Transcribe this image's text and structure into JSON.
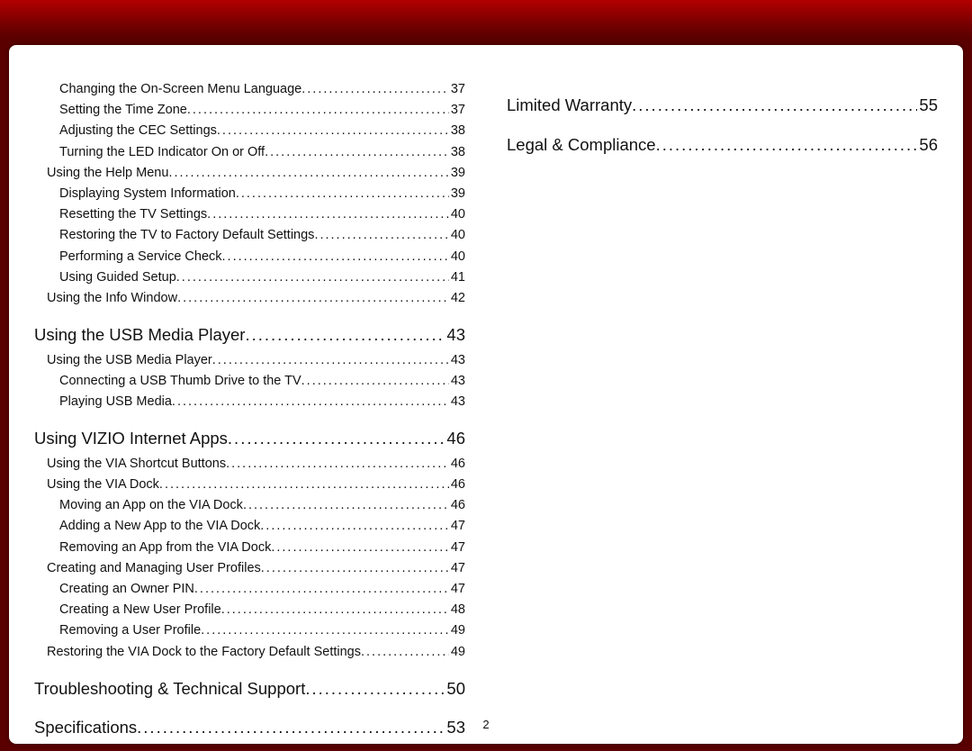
{
  "page_number": "2",
  "columns": [
    [
      {
        "level": 2,
        "title": "Changing the On-Screen Menu Language",
        "page": "37"
      },
      {
        "level": 2,
        "title": "Setting the Time Zone",
        "page": "37"
      },
      {
        "level": 2,
        "title": "Adjusting the CEC Settings",
        "page": "38"
      },
      {
        "level": 2,
        "title": "Turning the LED Indicator On or Off",
        "page": "38"
      },
      {
        "level": 1,
        "title": "Using the Help Menu",
        "page": "39"
      },
      {
        "level": 2,
        "title": "Displaying System Information",
        "page": "39"
      },
      {
        "level": 2,
        "title": "Resetting the TV Settings",
        "page": "40"
      },
      {
        "level": 2,
        "title": "Restoring the TV to Factory Default Settings",
        "page": "40"
      },
      {
        "level": 2,
        "title": "Performing a Service Check",
        "page": "40"
      },
      {
        "level": 2,
        "title": "Using Guided Setup",
        "page": "41"
      },
      {
        "level": 1,
        "title": "Using the Info Window",
        "page": "42"
      },
      {
        "level": 0,
        "title": "Using the USB Media Player",
        "page": "43"
      },
      {
        "level": 1,
        "title": "Using the USB Media Player",
        "page": "43"
      },
      {
        "level": 2,
        "title": "Connecting a USB Thumb Drive to the TV",
        "page": "43"
      },
      {
        "level": 2,
        "title": "Playing USB Media",
        "page": "43"
      },
      {
        "level": 0,
        "title": "Using VIZIO Internet Apps",
        "page": "46"
      },
      {
        "level": 1,
        "title": "Using the VIA Shortcut Buttons",
        "page": "46"
      },
      {
        "level": 1,
        "title": "Using the VIA Dock",
        "page": "46"
      },
      {
        "level": 2,
        "title": "Moving an App on the VIA Dock",
        "page": "46"
      },
      {
        "level": 2,
        "title": "Adding a New App to the VIA Dock",
        "page": "47"
      },
      {
        "level": 2,
        "title": "Removing an App from the VIA Dock",
        "page": "47"
      },
      {
        "level": 1,
        "title": "Creating and Managing User Profiles",
        "page": "47"
      },
      {
        "level": 2,
        "title": "Creating an Owner PIN",
        "page": "47"
      },
      {
        "level": 2,
        "title": "Creating a New User Profile",
        "page": "48"
      },
      {
        "level": 2,
        "title": "Removing a User Profile",
        "page": "49"
      },
      {
        "level": 1,
        "title": "Restoring the VIA Dock to the Factory Default Settings",
        "page": "49"
      },
      {
        "level": 0,
        "title": "Troubleshooting & Technical Support",
        "page": "50"
      },
      {
        "level": 0,
        "title": "Specifications",
        "page": "53"
      }
    ],
    [
      {
        "level": 0,
        "title": "Limited Warranty",
        "page": "55"
      },
      {
        "level": 0,
        "title": "Legal & Compliance",
        "page": "56"
      }
    ]
  ]
}
